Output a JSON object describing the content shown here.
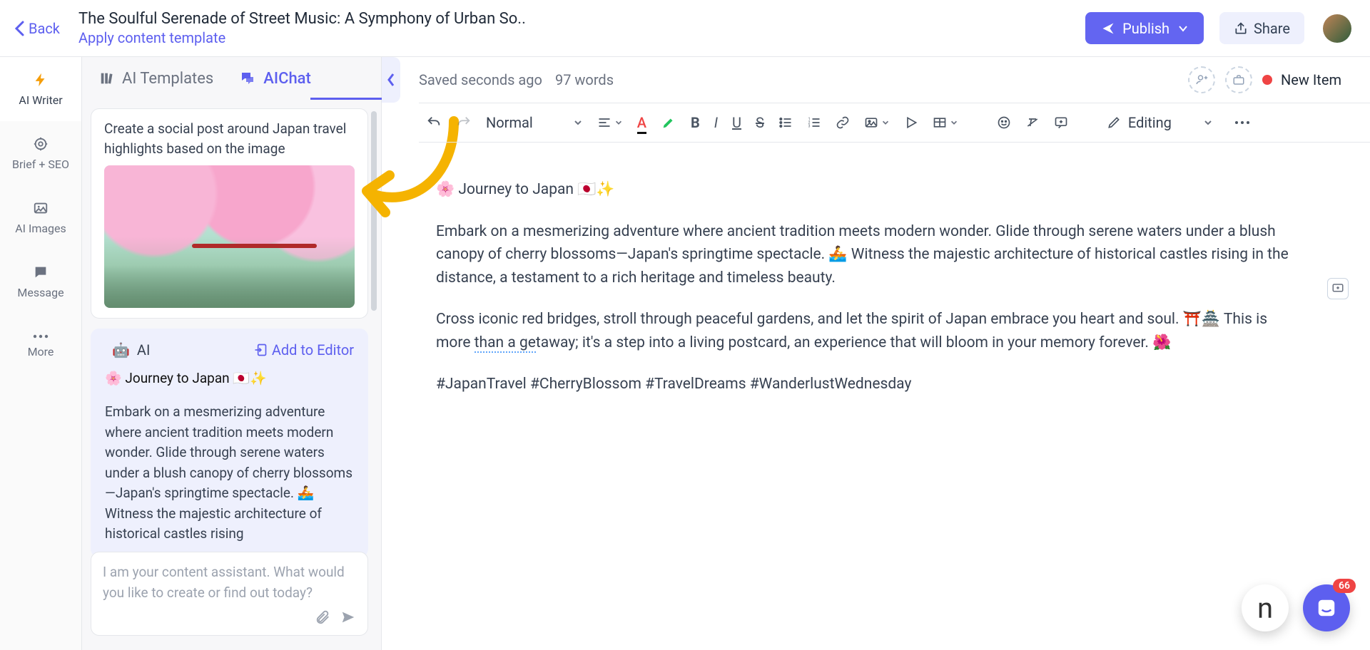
{
  "header": {
    "back": "Back",
    "title": "The Soulful Serenade of Street Music: A Symphony of Urban So..",
    "apply_template": "Apply content template",
    "publish": "Publish",
    "share": "Share"
  },
  "rail": [
    {
      "icon": "bolt",
      "label": "AI Writer"
    },
    {
      "icon": "target",
      "label": "Brief + SEO"
    },
    {
      "icon": "image",
      "label": "AI Images"
    },
    {
      "icon": "chat",
      "label": "Message"
    },
    {
      "icon": "dots",
      "label": "More"
    }
  ],
  "panel": {
    "tab_templates": "AI Templates",
    "tab_chat": "AIChat",
    "user_prompt": "Create a social post around Japan travel highlights based on the image",
    "ai_label": "AI",
    "add_to_editor": "Add to Editor",
    "ai_title": "🌸 Journey to Japan 🇯🇵✨",
    "ai_body": "Embark on a mesmerizing adventure where ancient tradition meets modern wonder. Glide through serene waters under a blush canopy of cherry blossoms—Japan's springtime spectacle. 🚣 Witness the majestic architecture of historical castles rising",
    "chat_placeholder": "I am your content assistant. What would you like to create or find out today?"
  },
  "editor_meta": {
    "saved": "Saved seconds ago",
    "wordcount": "97 words",
    "new_item": "New Item"
  },
  "toolbar": {
    "paragraph": "Normal",
    "mode": "Editing"
  },
  "document": {
    "line1": "🌸 Journey to Japan 🇯🇵✨",
    "para1": "Embark on a mesmerizing adventure where ancient tradition meets modern wonder. Glide through serene waters under a blush canopy of cherry blossoms—Japan's springtime spectacle. 🚣 Witness the majestic architecture of historical castles rising in the distance, a testament to a rich heritage and timeless beauty.",
    "para2a": "Cross iconic red bridges, stroll through peaceful gardens, and let the spirit of Japan embrace you heart and soul. ⛩️🏯 This is more ",
    "para2_link": "than a ge",
    "para2b": "taway; it's a step into a living postcard, an experience that will bloom in your memory forever. 🌺",
    "hashtags": "#JapanTravel #CherryBlossom #TravelDreams #WanderlustWednesday"
  },
  "badge_count": "66"
}
